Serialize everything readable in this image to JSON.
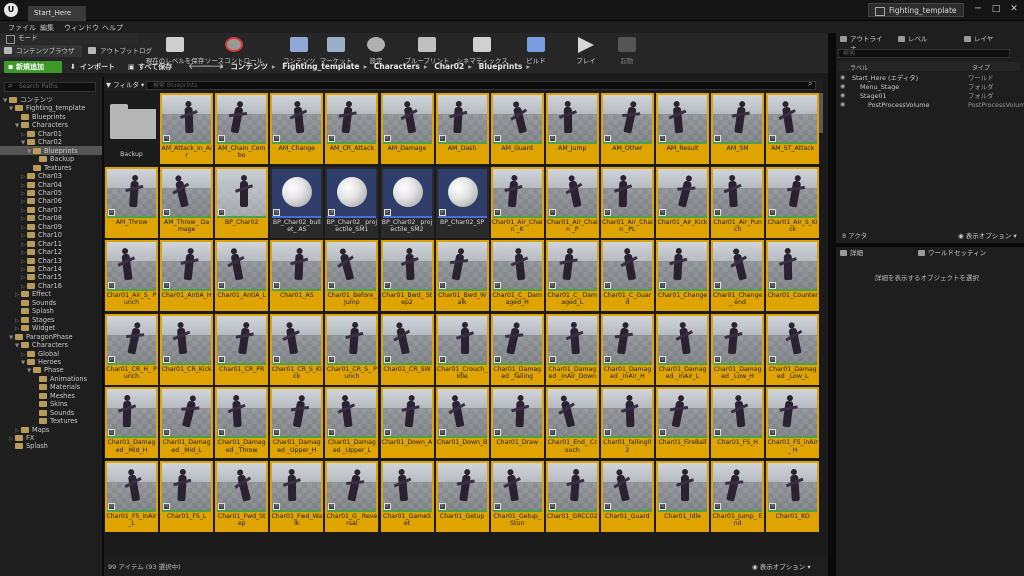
{
  "window": {
    "doc_tab": "Start_Here",
    "project_name": "Fighting_template"
  },
  "menu": [
    "ファイル",
    "編集",
    "ウィンドウ",
    "ヘルプ"
  ],
  "left_tabs": {
    "mode": "モード",
    "content_browser": "コンテンツブラウザ",
    "output_log": "アウトプットログ"
  },
  "toolbar": {
    "save": "現在のレベルを保存",
    "source_control": "ソースコントロール",
    "content": "コンテンツ",
    "marketplace": "マーケット",
    "settings": "設定",
    "blueprints": "ブループリント",
    "cinematics": "シネマティックス",
    "build": "ビルド",
    "play": "プレイ",
    "launch": "起動"
  },
  "cb_toolbar": {
    "add_new": "新規追加",
    "import": "インポート",
    "save_all": "すべて保存"
  },
  "breadcrumb": [
    "コンテンツ",
    "Fighting_template",
    "Characters",
    "Char02",
    "Blueprints"
  ],
  "sources": {
    "search_placeholder": "Search Paths",
    "tree": [
      {
        "label": "コンテンツ",
        "depth": 0,
        "arrow": "▼"
      },
      {
        "label": "Fighting_template",
        "depth": 1,
        "arrow": "▼"
      },
      {
        "label": "Blueprints",
        "depth": 2,
        "arrow": ""
      },
      {
        "label": "Characters",
        "depth": 2,
        "arrow": "▼"
      },
      {
        "label": "Char01",
        "depth": 3,
        "arrow": "▷"
      },
      {
        "label": "Char02",
        "depth": 3,
        "arrow": "▼"
      },
      {
        "label": "Blueprints",
        "depth": 4,
        "arrow": "▼"
      },
      {
        "label": "Backup",
        "depth": 5,
        "arrow": ""
      },
      {
        "label": "Textures",
        "depth": 4,
        "arrow": ""
      },
      {
        "label": "Char03",
        "depth": 3,
        "arrow": "▷"
      },
      {
        "label": "Char04",
        "depth": 3,
        "arrow": "▷"
      },
      {
        "label": "Char05",
        "depth": 3,
        "arrow": "▷"
      },
      {
        "label": "Char06",
        "depth": 3,
        "arrow": "▷"
      },
      {
        "label": "Char07",
        "depth": 3,
        "arrow": "▷"
      },
      {
        "label": "Char08",
        "depth": 3,
        "arrow": "▷"
      },
      {
        "label": "Char09",
        "depth": 3,
        "arrow": "▷"
      },
      {
        "label": "Char10",
        "depth": 3,
        "arrow": "▷"
      },
      {
        "label": "Char11",
        "depth": 3,
        "arrow": "▷"
      },
      {
        "label": "Char12",
        "depth": 3,
        "arrow": "▷"
      },
      {
        "label": "Char13",
        "depth": 3,
        "arrow": "▷"
      },
      {
        "label": "Char14",
        "depth": 3,
        "arrow": "▷"
      },
      {
        "label": "Char15",
        "depth": 3,
        "arrow": "▷"
      },
      {
        "label": "Char16",
        "depth": 3,
        "arrow": "▷"
      },
      {
        "label": "Effect",
        "depth": 2,
        "arrow": "▷"
      },
      {
        "label": "Sounds",
        "depth": 2,
        "arrow": ""
      },
      {
        "label": "Splash",
        "depth": 2,
        "arrow": ""
      },
      {
        "label": "Stages",
        "depth": 2,
        "arrow": "▷"
      },
      {
        "label": "Widget",
        "depth": 2,
        "arrow": "▷"
      },
      {
        "label": "ParagonPhase",
        "depth": 1,
        "arrow": "▼"
      },
      {
        "label": "Characters",
        "depth": 2,
        "arrow": "▼"
      },
      {
        "label": "Global",
        "depth": 3,
        "arrow": "▷"
      },
      {
        "label": "Heroes",
        "depth": 3,
        "arrow": "▼"
      },
      {
        "label": "Phase",
        "depth": 4,
        "arrow": "▼"
      },
      {
        "label": "Animations",
        "depth": 5,
        "arrow": ""
      },
      {
        "label": "Materials",
        "depth": 5,
        "arrow": ""
      },
      {
        "label": "Meshes",
        "depth": 5,
        "arrow": ""
      },
      {
        "label": "Skins",
        "depth": 5,
        "arrow": ""
      },
      {
        "label": "Sounds",
        "depth": 5,
        "arrow": ""
      },
      {
        "label": "Textures",
        "depth": 5,
        "arrow": ""
      },
      {
        "label": "Maps",
        "depth": 2,
        "arrow": "▷"
      },
      {
        "label": "FX",
        "depth": 1,
        "arrow": "▷"
      },
      {
        "label": "Splash",
        "depth": 1,
        "arrow": ""
      }
    ]
  },
  "content": {
    "filter_label": "フィルタ",
    "search_placeholder": "検索 Blueprints",
    "assets": [
      {
        "name": "Backup",
        "kind": "folder"
      },
      {
        "name": "AM_Attack_in_Air",
        "kind": "anim"
      },
      {
        "name": "AM_Chain_Combo",
        "kind": "anim"
      },
      {
        "name": "AM_Change",
        "kind": "anim"
      },
      {
        "name": "AM_CR_Attack",
        "kind": "anim"
      },
      {
        "name": "AM_Damage",
        "kind": "anim"
      },
      {
        "name": "AM_Dash",
        "kind": "anim"
      },
      {
        "name": "AM_Guard",
        "kind": "anim"
      },
      {
        "name": "AM_Jump",
        "kind": "anim"
      },
      {
        "name": "AM_Other",
        "kind": "anim"
      },
      {
        "name": "AM_Result",
        "kind": "anim"
      },
      {
        "name": "AM_SM",
        "kind": "anim"
      },
      {
        "name": "AM_ST_Attack",
        "kind": "anim"
      },
      {
        "name": "AM_Throw",
        "kind": "anim"
      },
      {
        "name": "AM_Throw_ Damage",
        "kind": "anim"
      },
      {
        "name": "BP_Char02",
        "kind": "bpchar"
      },
      {
        "name": "BP_Char02_bullet_ AS",
        "kind": "bp"
      },
      {
        "name": "BP_Char02_ projectile_SM1",
        "kind": "bp"
      },
      {
        "name": "BP_Char02_ projectile_SM2",
        "kind": "bp"
      },
      {
        "name": "BP_Char02_SP",
        "kind": "bp"
      },
      {
        "name": "Char01_Air_Chain _K",
        "kind": "anim"
      },
      {
        "name": "Char01_Air_Chain _P",
        "kind": "anim"
      },
      {
        "name": "Char01_Air_Chain _PL",
        "kind": "anim"
      },
      {
        "name": "Char01_Air_Kick",
        "kind": "anim"
      },
      {
        "name": "Char01_Air_Punch",
        "kind": "anim"
      },
      {
        "name": "Char01_Air_S_Kick",
        "kind": "anim"
      },
      {
        "name": "Char01_Air_S_ Punch",
        "kind": "anim"
      },
      {
        "name": "Char01_AntiA_H",
        "kind": "anim"
      },
      {
        "name": "Char01_AntiA_L",
        "kind": "anim"
      },
      {
        "name": "Char01_AS",
        "kind": "anim"
      },
      {
        "name": "Char01_Before_ Jump",
        "kind": "anim"
      },
      {
        "name": "Char01_Bwd_ Step2",
        "kind": "anim"
      },
      {
        "name": "Char01_Bwd_Walk",
        "kind": "anim"
      },
      {
        "name": "Char01_C_ Damaged_H",
        "kind": "anim"
      },
      {
        "name": "Char01_C_ Damaged_L",
        "kind": "anim"
      },
      {
        "name": "Char01_C_Guard",
        "kind": "anim"
      },
      {
        "name": "Char01_Change",
        "kind": "anim"
      },
      {
        "name": "Char01_Change_ end",
        "kind": "anim"
      },
      {
        "name": "Char01_Counter",
        "kind": "anim"
      },
      {
        "name": "Char01_CR_H_ Punch",
        "kind": "anim"
      },
      {
        "name": "Char01_CR_Kick",
        "kind": "anim"
      },
      {
        "name": "Char01_CR_PR",
        "kind": "anim"
      },
      {
        "name": "Char01_CR_S_Kick",
        "kind": "anim"
      },
      {
        "name": "Char01_CR_S_ Punch",
        "kind": "anim"
      },
      {
        "name": "Char01_CR_SW",
        "kind": "anim"
      },
      {
        "name": "Char01_Crouch_ Idle",
        "kind": "anim"
      },
      {
        "name": "Char01_Damaged _falling",
        "kind": "anim"
      },
      {
        "name": "Char01_Damaged _inAir_Down",
        "kind": "anim"
      },
      {
        "name": "Char01_Damaged _inAir_H",
        "kind": "anim"
      },
      {
        "name": "Char01_Damaged _inAir_L",
        "kind": "anim"
      },
      {
        "name": "Char01_Damaged _Low_H",
        "kind": "anim"
      },
      {
        "name": "Char01_Damaged _Low_L",
        "kind": "anim"
      },
      {
        "name": "Char01_Damaged _Mid_H",
        "kind": "anim"
      },
      {
        "name": "Char01_Damaged _Mid_L",
        "kind": "anim"
      },
      {
        "name": "Char01_Damaged _Throw",
        "kind": "anim"
      },
      {
        "name": "Char01_Damaged _Upper_H",
        "kind": "anim"
      },
      {
        "name": "Char01_Damaged _Upper_L",
        "kind": "anim"
      },
      {
        "name": "Char01_Down_A",
        "kind": "anim"
      },
      {
        "name": "Char01_Down_B",
        "kind": "anim"
      },
      {
        "name": "Char01_Draw",
        "kind": "anim"
      },
      {
        "name": "Char01_End_ Crouch",
        "kind": "anim"
      },
      {
        "name": "Char01_falling02",
        "kind": "anim"
      },
      {
        "name": "Char01_FireBall",
        "kind": "anim"
      },
      {
        "name": "Char01_FS_H",
        "kind": "anim"
      },
      {
        "name": "Char01_FS_inAir_ H",
        "kind": "anim"
      },
      {
        "name": "Char01_FS_inAir_L",
        "kind": "anim"
      },
      {
        "name": "Char01_FS_L",
        "kind": "anim"
      },
      {
        "name": "Char01_Fwd_Step",
        "kind": "anim"
      },
      {
        "name": "Char01_Fwd_Walk",
        "kind": "anim"
      },
      {
        "name": "Char01_G_ Reversal",
        "kind": "anim"
      },
      {
        "name": "Char01_GameSet",
        "kind": "anim"
      },
      {
        "name": "Char01_Getup",
        "kind": "anim"
      },
      {
        "name": "Char01_Getup_ Stun",
        "kind": "anim"
      },
      {
        "name": "Char01_GRCC02",
        "kind": "anim"
      },
      {
        "name": "Char01_Guard",
        "kind": "anim"
      },
      {
        "name": "Char01_Idle",
        "kind": "anim"
      },
      {
        "name": "Char01_Jump_ End",
        "kind": "anim"
      },
      {
        "name": "Char01_KO",
        "kind": "anim"
      }
    ],
    "status_count": "99 アイテム (93 選択中)",
    "view_options": "表示オプション"
  },
  "outliner": {
    "tabs": [
      "アウトライナ",
      "レベル",
      "レイヤ"
    ],
    "search_placeholder": "検索",
    "col_label": "ラベル",
    "col_type": "タイプ",
    "rows": [
      {
        "label": "Start_Here (エディタ)",
        "type": "ワールド",
        "depth": 0
      },
      {
        "label": "Menu_Stage",
        "type": "フォルダ",
        "depth": 1
      },
      {
        "label": "Stage01",
        "type": "フォルダ",
        "depth": 1
      },
      {
        "label": "PostProcessVolume",
        "type": "PostProcessVolume",
        "depth": 2
      }
    ],
    "actor_count": "8 アクタ",
    "view_options": "表示オプション"
  },
  "details": {
    "tabs": [
      "詳細",
      "ワールドセッティン"
    ],
    "empty_text": "詳細を表示するオブジェクトを選択"
  },
  "colors": {
    "selected_tile": "#e0a400",
    "anim_stripe": "#4aa34a",
    "bp_stripe": "#4a6ed8",
    "add_button": "#3d9a2a"
  }
}
